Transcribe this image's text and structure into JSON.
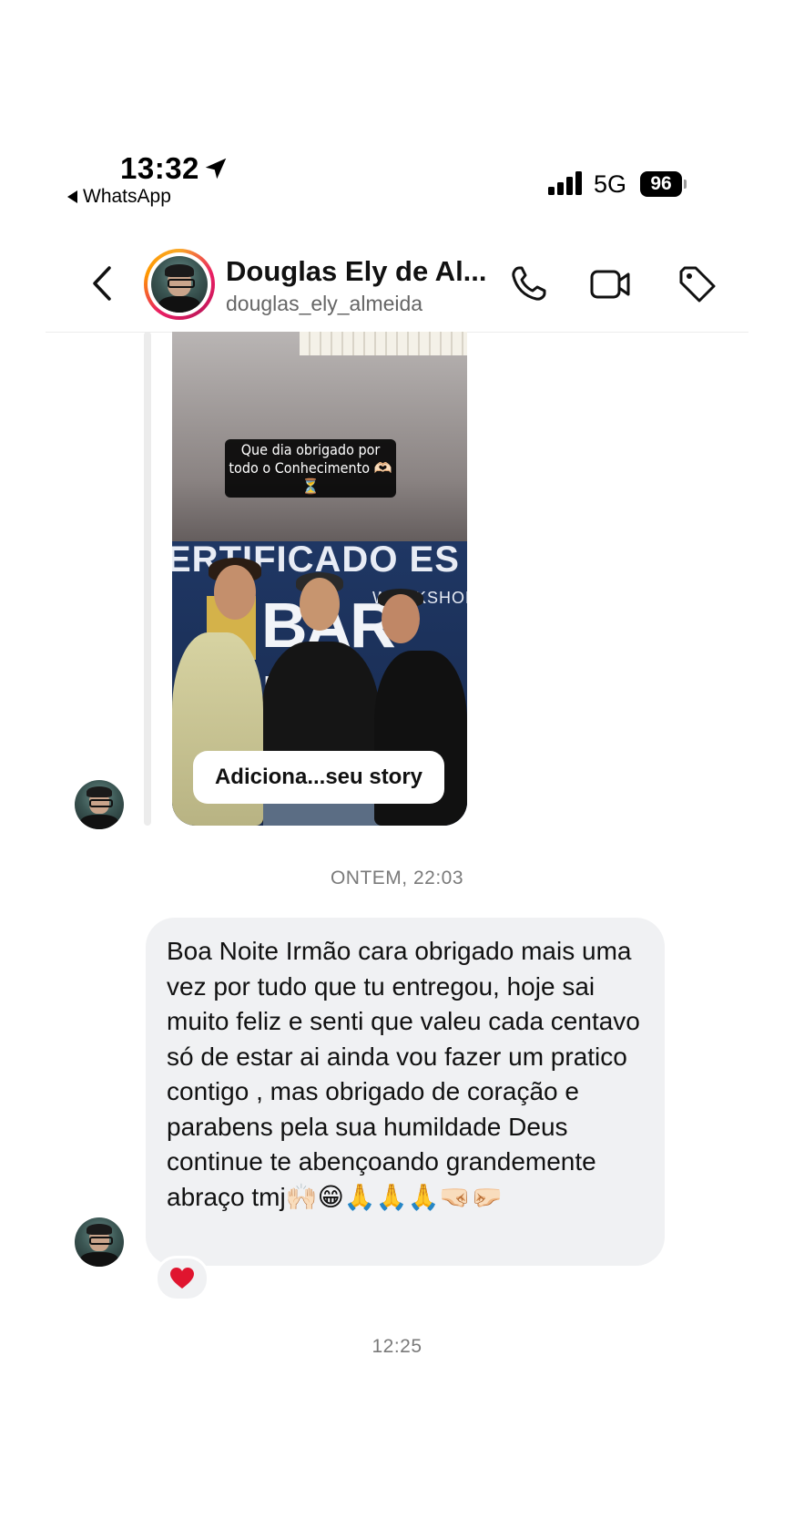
{
  "status_bar": {
    "time": "13:32",
    "back_app": "WhatsApp",
    "network": "5G",
    "battery": "96"
  },
  "header": {
    "name": "Douglas Ely de Al...",
    "username": "douglas_ely_almeida",
    "icons": [
      "back-chevron-icon",
      "phone-icon",
      "video-icon",
      "tag-icon"
    ]
  },
  "story_reply": {
    "caption": "Que dia obrigado por todo o Conhecimento 🫶🏻⏳",
    "banner_text": "ERTIFICADO ES",
    "banner_sub": "WORKSHOP",
    "banner_big": "BAR BO",
    "button_label": "Adiciona...seu story"
  },
  "timestamps": {
    "first": "ONTEM, 22:03",
    "second": "12:25"
  },
  "message": {
    "text": "Boa Noite Irmão cara obrigado mais uma vez por tudo que tu entregou, hoje sai muito feliz e senti que valeu cada centavo só de estar ai ainda vou fazer um pratico contigo , mas obrigado de coração e parabens pela sua humildade Deus continue te abençoando grandemente abraço tmj🙌🏻😁🙏🙏🙏🤜🏻🤛🏻",
    "reaction": "❤️"
  },
  "colors": {
    "bubble_bg": "#f0f1f3",
    "ring_gradient": [
      "#f9a825",
      "#e91e63"
    ],
    "timestamp": "#7a7a7a"
  }
}
